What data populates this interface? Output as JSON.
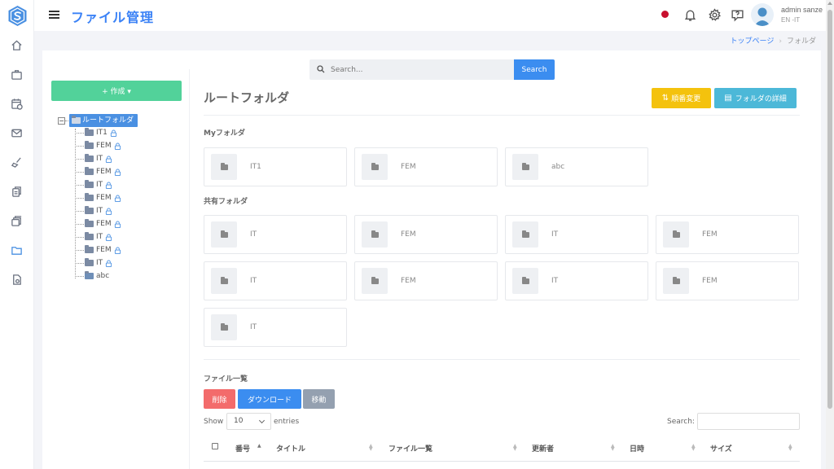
{
  "header": {
    "title": "ファイル管理",
    "user_name": "admin sanze",
    "user_lang": "EN -IT"
  },
  "breadcrumb": {
    "home": "トップページ",
    "current": "フォルダ"
  },
  "search": {
    "placeholder": "Search...",
    "button": "Search"
  },
  "create_button": "+ 作成 ▾",
  "tree": {
    "root": "ルートフォルダ",
    "items": [
      {
        "label": "IT1",
        "locked": true
      },
      {
        "label": "FEM",
        "locked": true
      },
      {
        "label": "IT",
        "locked": true
      },
      {
        "label": "FEM",
        "locked": true
      },
      {
        "label": "IT",
        "locked": true
      },
      {
        "label": "FEM",
        "locked": true
      },
      {
        "label": "IT",
        "locked": true
      },
      {
        "label": "FEM",
        "locked": true
      },
      {
        "label": "IT",
        "locked": true
      },
      {
        "label": "FEM",
        "locked": true
      },
      {
        "label": "IT",
        "locked": true
      },
      {
        "label": "abc",
        "locked": false
      }
    ]
  },
  "main": {
    "title": "ルートフォルダ",
    "order_button": "順番変更",
    "detail_button": "フォルダの詳細",
    "my_folders_label": "Myフォルダ",
    "my_folders": [
      "IT1",
      "FEM",
      "abc"
    ],
    "shared_label": "共有フォルダ",
    "shared_folders": [
      "IT",
      "FEM",
      "IT",
      "FEM",
      "IT",
      "FEM",
      "IT",
      "FEM",
      "IT"
    ]
  },
  "file_list": {
    "title": "ファイル一覧",
    "delete": "削除",
    "download": "ダウンロード",
    "move": "移動",
    "show_label": "Show",
    "entries_value": "10",
    "entries_label": "entries",
    "search_label": "Search:",
    "columns": [
      "番号",
      "タイトル",
      "ファイル一覧",
      "更新者",
      "日時",
      "サイズ"
    ]
  },
  "colors": {
    "accent": "#3b8df0",
    "create": "#52d29a",
    "order": "#f4c20d",
    "detail": "#4cb8d8",
    "delete": "#f36b6b",
    "move": "#94a0b0",
    "status_dot": "#c8102e"
  }
}
